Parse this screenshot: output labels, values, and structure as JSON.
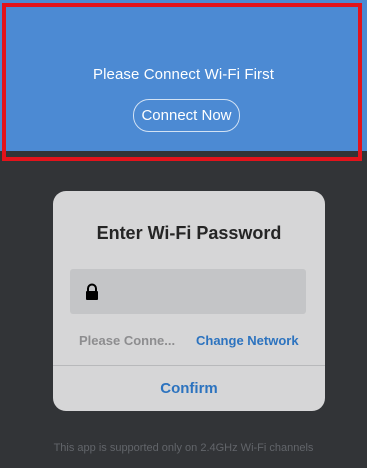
{
  "banner": {
    "title": "Please Connect Wi-Fi First",
    "connect_label": "Connect Now"
  },
  "dialog": {
    "title": "Enter Wi-Fi Password",
    "password_value": "",
    "lock_icon": "lock-icon",
    "current_network": "Please Conne...",
    "change_network_label": "Change Network",
    "confirm_label": "Confirm"
  },
  "footer": {
    "note": "This app is supported only on 2.4GHz Wi-Fi channels"
  },
  "colors": {
    "banner": "#4c8ad3",
    "highlight": "#e3131b",
    "link": "#2c73bf",
    "overlay": "#323437"
  }
}
